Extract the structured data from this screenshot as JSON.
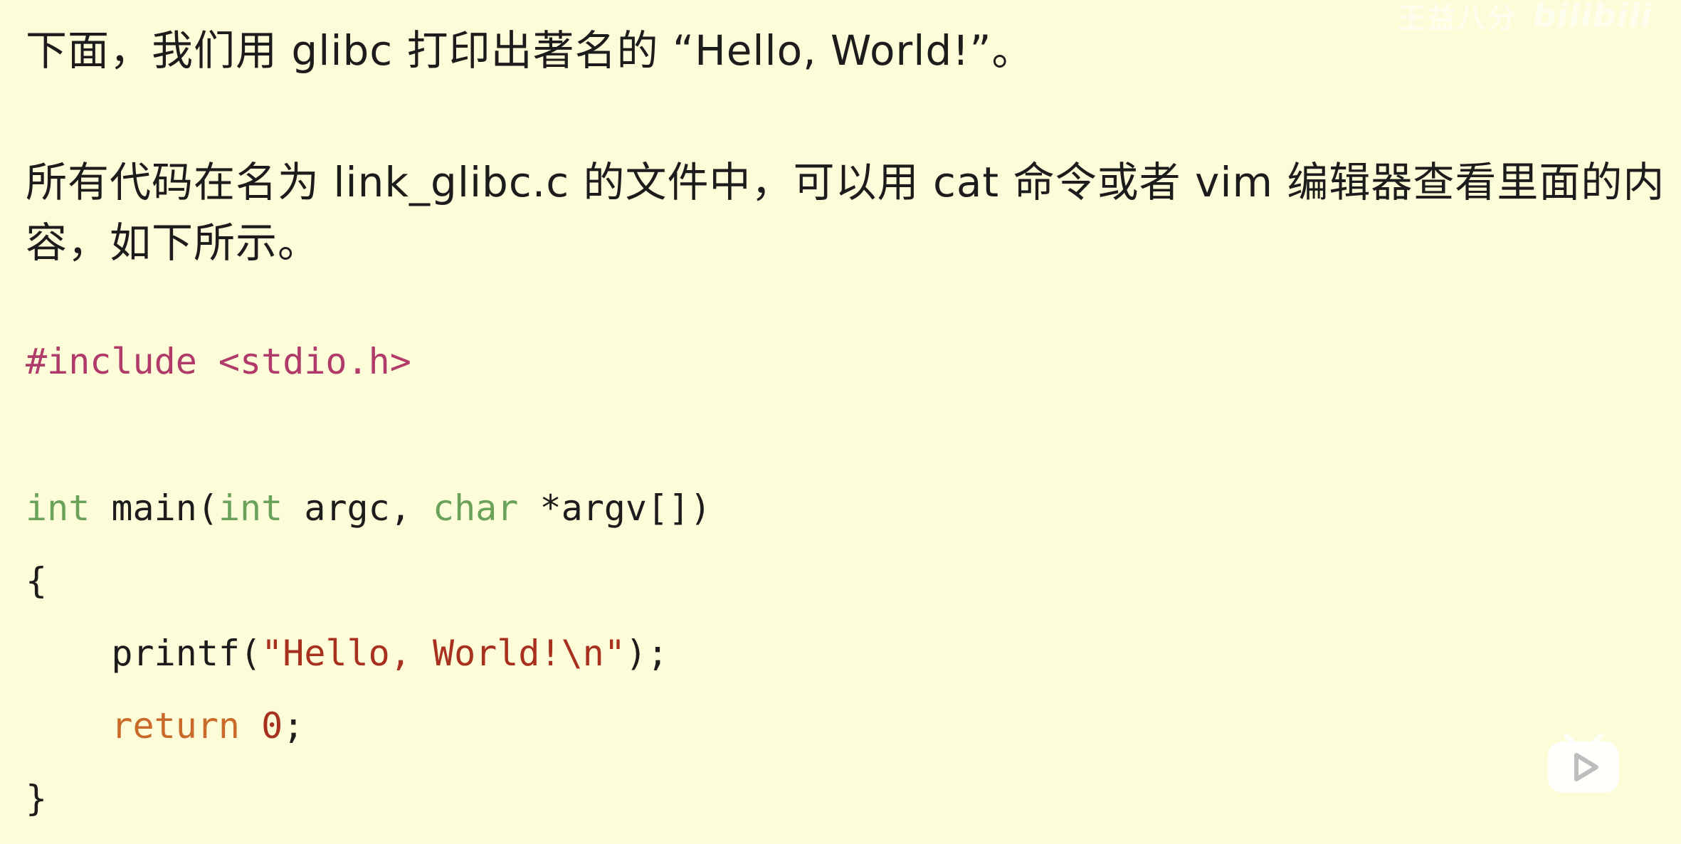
{
  "text": {
    "para1": "下面，我们用 glibc 打印出著名的 “Hello, World!”。",
    "para2_line1": "所有代码在名为 link_glibc.c 的文件中，可以用 cat 命令或者 vim 编辑器查看里面的内",
    "para2_line2": "容，如下所示。"
  },
  "code": {
    "line1": {
      "pre": "#include <stdio.h>"
    },
    "line2": {
      "t1": "int",
      "t2": " main(",
      "t3": "int",
      "t4": " argc, ",
      "t5": "char",
      "t6": " *argv[])"
    },
    "line3": "{",
    "line4": {
      "indent": "    ",
      "fn": "printf(",
      "str": "\"Hello, World!\\n\"",
      "end": ");"
    },
    "line5": {
      "indent": "    ",
      "kw": "return",
      "sp": " ",
      "num": "0",
      "end": ";"
    },
    "line6": "}"
  },
  "watermark": {
    "text": "王益八分",
    "logo": "bilibili"
  },
  "colors": {
    "background": "#fcfcd9",
    "preprocessor": "#b03a6a",
    "type": "#6aa25a",
    "keyword": "#c96a2a",
    "string": "#a8301e"
  },
  "icons": {
    "play": "play-icon"
  }
}
